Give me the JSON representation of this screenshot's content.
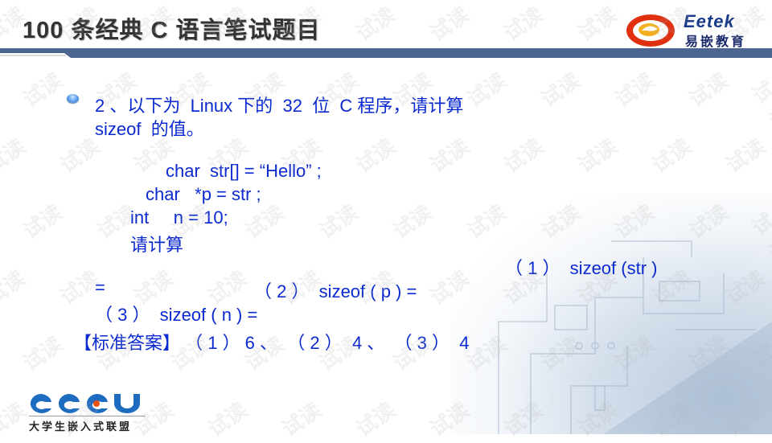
{
  "header": {
    "title": "100 条经典 C 语言笔试题目",
    "bar_color": "#4a6590"
  },
  "logo_top": {
    "brand": "Eetek",
    "subtitle": "易嵌教育",
    "icon": "eetek-ring-logo-icon"
  },
  "logo_bottom": {
    "brand": "CCCU",
    "subtitle": "大学生嵌入式联盟",
    "icon": "cccu-logo-icon"
  },
  "question": {
    "line1": "2 、以下为  Linux 下的  32  位  C 程序，请计算",
    "line2": "sizeof  的值。",
    "code": [
      "char  str[] = “Hello” ;",
      "char   *p = str ;",
      "int     n = 10;",
      "请计算"
    ],
    "q1": "（ 1 ）  sizeof (str )",
    "q1_eq": "=",
    "q2": "（ 2 ）  sizeof ( p ) =",
    "q3": "（ 3 ）  sizeof ( n ) =",
    "answer": "【标准答案】 （ 1 ） 6 、  （ 2 ）  4 、  （ 3 ）  4"
  },
  "colors": {
    "text": "#0a2ad0",
    "title": "#333333"
  },
  "watermark": "试读"
}
